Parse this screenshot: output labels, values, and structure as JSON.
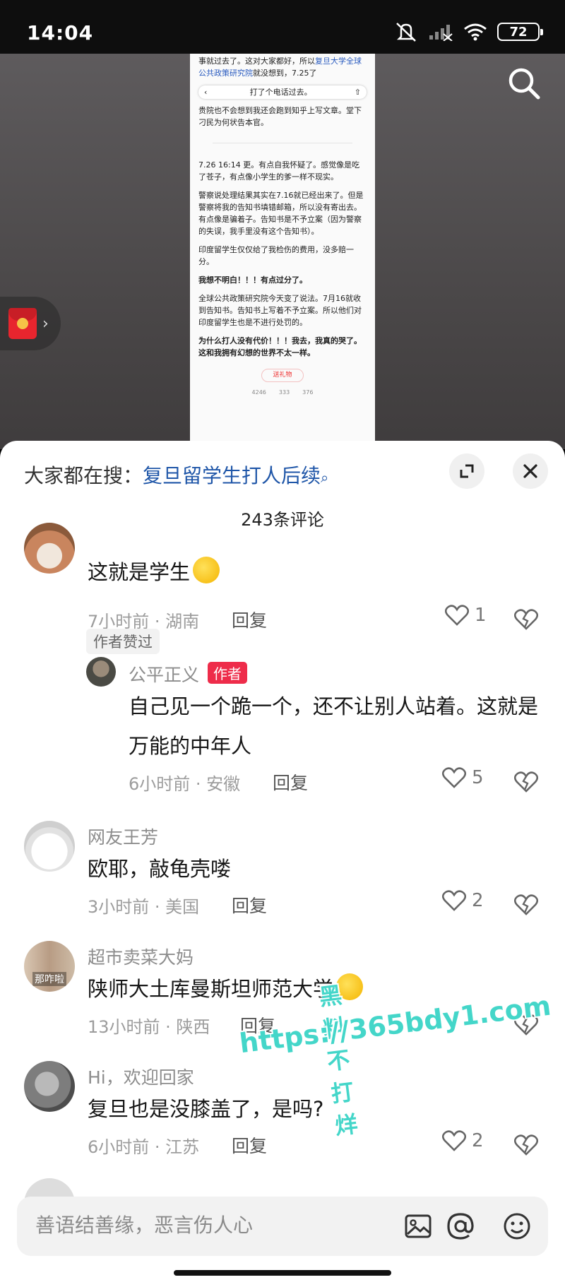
{
  "status": {
    "time": "14:04",
    "battery": "72"
  },
  "video": {
    "doc": {
      "p1_a": "事就过去了。这对大家都好，所以",
      "p1_link": "复旦大学全球公共政策研究院",
      "p1_b": "就没想到，7.25了",
      "header_label": "打了个电话过去。",
      "p2": "贵院也不会想到我还会跑到知乎上写文章。堂下刁民为何状告本官。",
      "p3": "7.26 16:14 更。有点自我怀疑了。感觉像是吃了苍子，有点像小学生的爹一样不现实。",
      "p4": "警察说处理结果其实在7.16就已经出来了。但是警察将我的告知书填错邮箱，所以没有寄出去。有点像是骗着子。告知书是不予立案（因为警察的失误，我手里没有这个告知书）。",
      "p5": "印度留学生仅仅给了我检伤的费用，没多赔一分。",
      "p6": "我想不明白！！！有点过分了。",
      "p7": "全球公共政策研究院今天变了说法。7月16就收到告知书。告知书上写着不予立案。所以他们对印度留学生也是不进行处罚的。",
      "p8": "为什么打人没有代价！！！我去，我真的哭了。这和我拥有幻想的世界不太一样。",
      "gift": "送礼物",
      "stat1": "4246",
      "stat2": "333",
      "stat3": "376"
    }
  },
  "sheet": {
    "trend_prefix": "大家都在搜：",
    "trend_query": "复旦留学生打人后续",
    "count": "243条评论"
  },
  "comments": {
    "c1": {
      "text": "这就是学生",
      "time": "7小时前 · 湖南",
      "reply": "回复",
      "likes": "1",
      "badge": "作者赞过"
    },
    "c1r": {
      "name": "公平正义",
      "tag": "作者",
      "text": "自己见一个跪一个，还不让别人站着。这就是万能的中年人",
      "time": "6小时前 · 安徽",
      "reply": "回复",
      "likes": "5"
    },
    "c2": {
      "name": "网友王芳",
      "text": "欧耶，敲龟壳喽",
      "time": "3小时前 · 美国",
      "reply": "回复",
      "likes": "2"
    },
    "c3": {
      "name": "超市卖菜大妈",
      "text": "陕师大土库曼斯坦师范大学",
      "time": "13小时前 · 陕西",
      "reply": "回复",
      "likes": "",
      "avatar_text": "那咋啦"
    },
    "c4": {
      "name": "Hi，欢迎回家",
      "text": "复旦也是没膝盖了，是吗?",
      "time": "6小时前 · 江苏",
      "reply": "回复",
      "likes": "2"
    }
  },
  "input": {
    "placeholder": "善语结善缘，恶言伤人心"
  },
  "watermark": {
    "line1": "黑料不打烊",
    "line2": "https://365bdy1.com"
  },
  "icons": [
    "mute-icon",
    "signal-icon",
    "wifi-icon",
    "battery-icon",
    "search-icon",
    "red-packet-icon",
    "expand-icon",
    "close-icon",
    "heart-icon",
    "broken-heart-icon",
    "image-icon",
    "at-icon",
    "emoji-icon"
  ],
  "colors": {
    "accent_red": "#ee2c4a",
    "trend_blue": "#1f56a8",
    "watermark_teal": "#44d6c9"
  }
}
